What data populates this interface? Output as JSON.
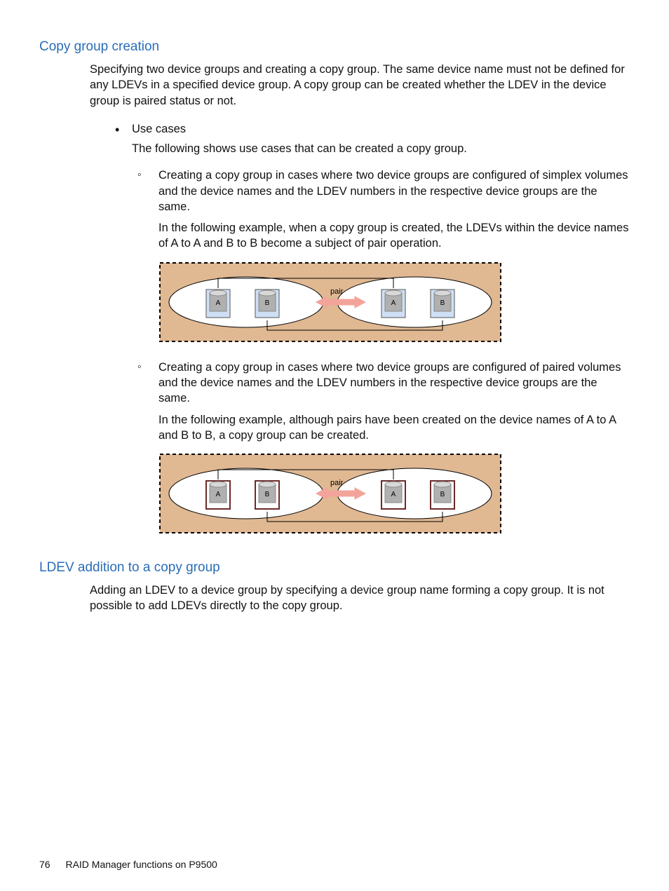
{
  "sections": {
    "copy_group_creation": {
      "heading": "Copy group creation",
      "intro": "Specifying two device groups and creating a copy group. The same device name must not be defined for any LDEVs in a specified device group. A copy group can be created whether the LDEV in the device group is paired status or not.",
      "bullet_label": "Use cases",
      "bullet_sub": "The following shows use cases that can be created a copy group.",
      "subitems": [
        {
          "para1": "Creating a copy group in cases where two device groups are configured of simplex volumes and the device names and the LDEV numbers in the respective device groups are the same.",
          "para2": "In the following example, when a copy group is created, the LDEVs within the device names of A to A and B to B become a subject of pair operation.",
          "diagram": {
            "labelA": "A",
            "labelB": "B",
            "pair": "pair",
            "mode": "simplex"
          }
        },
        {
          "para1": "Creating a copy group in cases where two device groups are configured of paired volumes and the device names and the LDEV numbers in the respective device groups are the same.",
          "para2": "In the following example, although pairs have been created on the device names of A to A and B to B, a copy group can be created.",
          "diagram": {
            "labelA": "A",
            "labelB": "B",
            "pair": "pair",
            "mode": "paired"
          }
        }
      ]
    },
    "ldev_addition": {
      "heading": "LDEV addition to a copy group",
      "intro": "Adding an LDEV to a device group by specifying a device group name forming a copy group. It is not possible to add LDEVs directly to the copy group."
    }
  },
  "footer": {
    "page_number": "76",
    "title": "RAID Manager functions on P9500"
  }
}
